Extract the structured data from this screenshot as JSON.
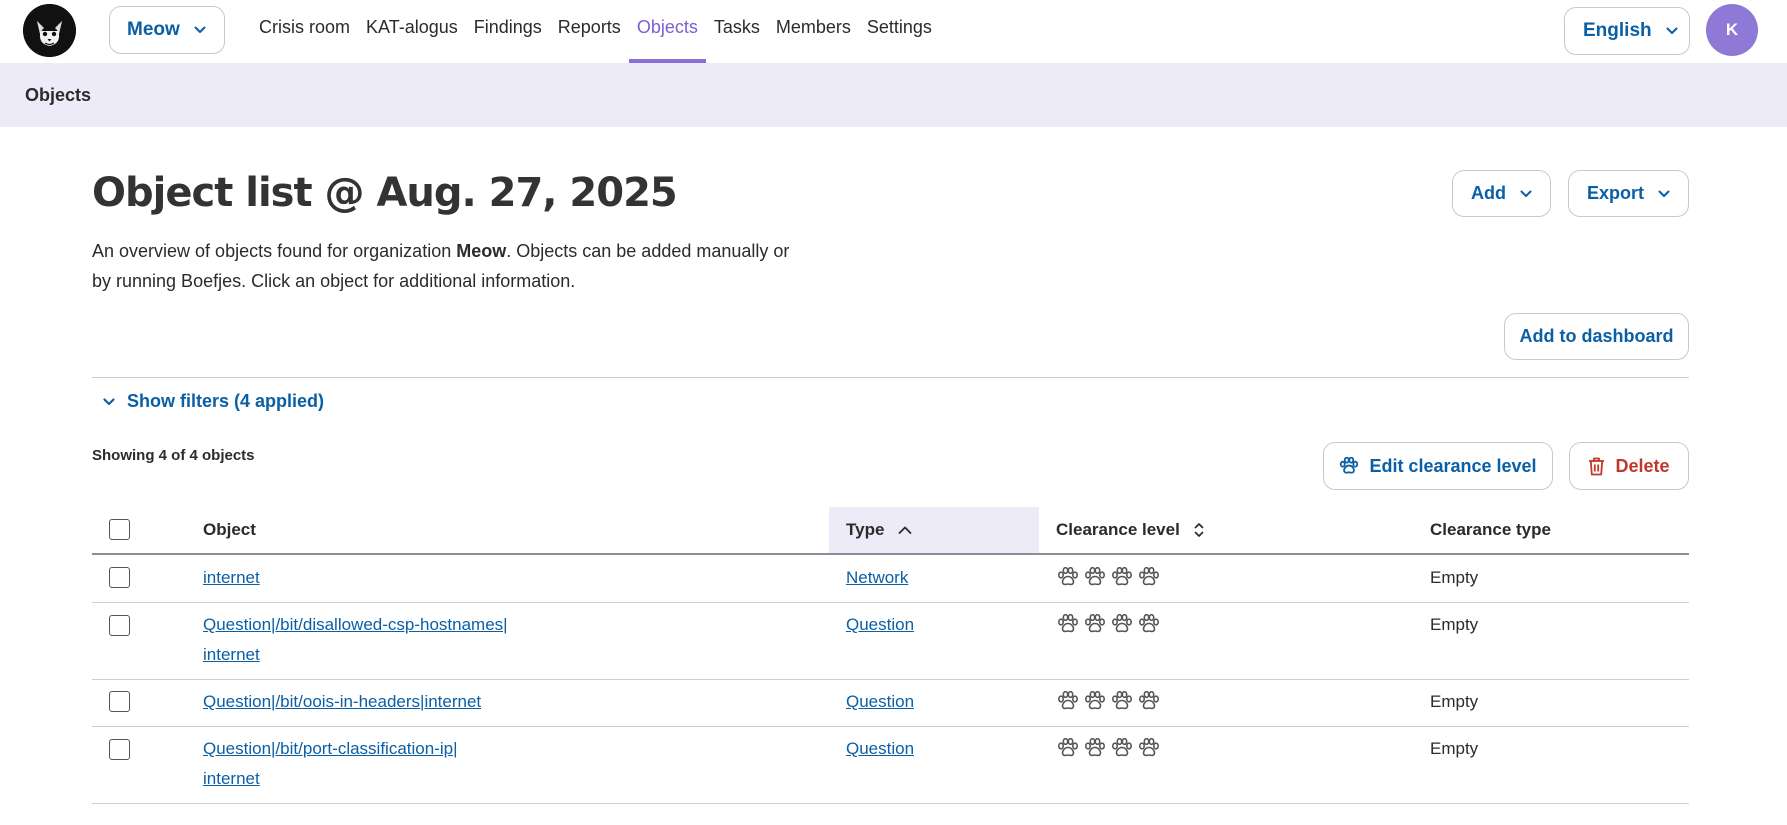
{
  "header": {
    "organization": "Meow",
    "nav": [
      {
        "label": "Crisis room",
        "active": false
      },
      {
        "label": "KAT-alogus",
        "active": false
      },
      {
        "label": "Findings",
        "active": false
      },
      {
        "label": "Reports",
        "active": false
      },
      {
        "label": "Objects",
        "active": true
      },
      {
        "label": "Tasks",
        "active": false
      },
      {
        "label": "Members",
        "active": false
      },
      {
        "label": "Settings",
        "active": false
      }
    ],
    "language": "English",
    "avatar_initial": "K"
  },
  "breadcrumb": "Objects",
  "page": {
    "title": "Object list @ Aug. 27, 2025",
    "intro_before": "An overview of objects found for organization ",
    "intro_org": "Meow",
    "intro_after": ". Objects can be added manually or by running Boefjes. Click an object for additional information.",
    "add_label": "Add",
    "export_label": "Export",
    "dashboard_label": "Add to dashboard",
    "filters_label": "Show filters (4 applied)",
    "showing_label": "Showing 4 of 4 objects",
    "edit_clearance_label": "Edit clearance level",
    "delete_label": "Delete"
  },
  "table": {
    "columns": {
      "object": "Object",
      "type": "Type",
      "clearance_level": "Clearance level",
      "clearance_type": "Clearance type"
    },
    "rows": [
      {
        "object_line1": "internet",
        "object_line2": "",
        "type": "Network",
        "clearance_level": 0,
        "clearance_type": "Empty"
      },
      {
        "object_line1": "Question|/bit/disallowed-csp-hostnames|",
        "object_line2": "internet",
        "type": "Question",
        "clearance_level": 0,
        "clearance_type": "Empty"
      },
      {
        "object_line1": "Question|/bit/oois-in-headers|internet",
        "object_line2": "",
        "type": "Question",
        "clearance_level": 0,
        "clearance_type": "Empty"
      },
      {
        "object_line1": "Question|/bit/port-classification-ip|",
        "object_line2": "internet",
        "type": "Question",
        "clearance_level": 0,
        "clearance_type": "Empty"
      }
    ]
  },
  "colors": {
    "accent": "#0b5fa5",
    "active_nav": "#7a5fcf",
    "crumb_bg": "#eeebf8",
    "avatar_bg": "#8e79d6",
    "danger": "#c0392b"
  }
}
